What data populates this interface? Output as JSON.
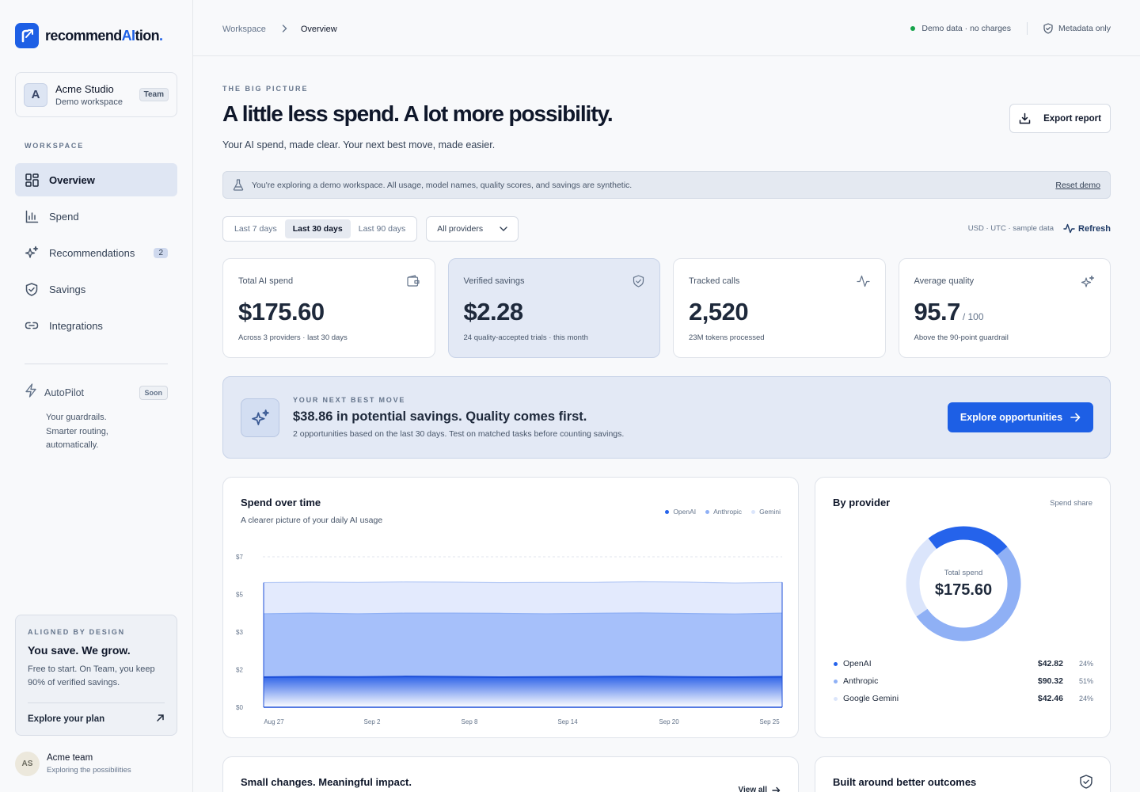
{
  "app": {
    "logo_prefix": "recommend",
    "logo_ai": "AI",
    "logo_suffix": "tion",
    "logo_dot": "."
  },
  "workspace": {
    "initial": "A",
    "name": "Acme Studio",
    "sub": "Demo workspace",
    "badge": "Team"
  },
  "sidebar": {
    "section": "WORKSPACE",
    "items": [
      {
        "label": "Overview",
        "icon": "grid-icon",
        "active": true
      },
      {
        "label": "Spend",
        "icon": "bar-chart-icon"
      },
      {
        "label": "Recommendations",
        "icon": "sparkles-icon",
        "count": "2"
      },
      {
        "label": "Savings",
        "icon": "shield-check-icon"
      },
      {
        "label": "Integrations",
        "icon": "link-icon"
      }
    ],
    "autopilot": {
      "title": "AutoPilot",
      "badge": "Soon",
      "desc": "Your guardrails. Smarter routing, automatically."
    },
    "plan": {
      "kicker": "ALIGNED BY DESIGN",
      "title": "You save. We grow.",
      "desc": "Free to start. On Team, you keep 90% of verified savings.",
      "link": "Explore your plan"
    },
    "user": {
      "initials": "AS",
      "name": "Acme team",
      "sub": "Exploring the possibilities"
    }
  },
  "topbar": {
    "crumb_root": "Workspace",
    "crumb_current": "Overview",
    "status": "Demo data · no charges",
    "privacy": "Metadata only"
  },
  "hero": {
    "kicker": "THE BIG PICTURE",
    "title": "A little less spend. A lot more possibility.",
    "sub": "Your AI spend, made clear. Your next best move, made easier.",
    "export": "Export report"
  },
  "banner": {
    "text": "You're exploring a demo workspace. All usage, model names, quality scores, and savings are synthetic.",
    "reset": "Reset demo"
  },
  "filters": {
    "ranges": [
      "Last 7 days",
      "Last 30 days",
      "Last 90 days"
    ],
    "selected_range": "Last 30 days",
    "provider": "All providers",
    "meta": "USD · UTC · sample data",
    "refresh": "Refresh"
  },
  "kpis": [
    {
      "label": "Total AI spend",
      "value": "$175.60",
      "unit": "",
      "note": "Across 3 providers · last 30 days",
      "icon": "wallet-icon"
    },
    {
      "label": "Verified savings",
      "value": "$2.28",
      "unit": "",
      "note": "24 quality-accepted trials · this month",
      "icon": "shield-check-icon"
    },
    {
      "label": "Tracked calls",
      "value": "2,520",
      "unit": "",
      "note": "23M tokens processed",
      "icon": "activity-icon"
    },
    {
      "label": "Average quality",
      "value": "95.7",
      "unit": "/ 100",
      "note": "Above the 90-point guardrail",
      "icon": "sparkles-icon"
    }
  ],
  "next_move": {
    "kicker": "YOUR NEXT BEST MOVE",
    "title": "$38.86 in potential savings. Quality comes first.",
    "sub": "2 opportunities based on the last 30 days. Test on matched tasks before counting savings.",
    "button": "Explore opportunities"
  },
  "spend_card": {
    "title": "Spend over time",
    "sub": "A clearer picture of your daily AI usage"
  },
  "provider_card": {
    "title": "By provider",
    "right": "Spend share",
    "center_label": "Total spend",
    "center_value": "$175.60",
    "rows": [
      {
        "name": "OpenAI",
        "value": "$42.82",
        "pct": "24%",
        "color": "#2563eb"
      },
      {
        "name": "Anthropic",
        "value": "$90.32",
        "pct": "51%",
        "color": "#8fb0f5"
      },
      {
        "name": "Google Gemini",
        "value": "$42.46",
        "pct": "24%",
        "color": "#dbe5fb"
      }
    ]
  },
  "bottom": {
    "left_title": "Small changes. Meaningful impact.",
    "view_all": "View all",
    "right_title": "Built around better outcomes"
  },
  "colors": {
    "accent": "#1d5fe5",
    "openai": "#2563eb",
    "anthropic": "#8fb0f5",
    "gemini": "#dbe5fb"
  },
  "chart_data": {
    "type": "area",
    "stacked": true,
    "x_ticks": [
      "Aug 27",
      "Sep 2",
      "Sep 8",
      "Sep 14",
      "Sep 20",
      "Sep 25"
    ],
    "y_ticks": [
      "$0",
      "$2",
      "$3",
      "$5",
      "$7"
    ],
    "ylim": [
      0,
      7
    ],
    "legend_position": "top-right",
    "series": [
      {
        "name": "OpenAI",
        "values": [
          1.4,
          1.42,
          1.41,
          1.43,
          1.42,
          1.4,
          1.41,
          1.42,
          1.43,
          1.41,
          1.4,
          1.42
        ]
      },
      {
        "name": "Anthropic",
        "values": [
          2.95,
          2.96,
          2.94,
          2.95,
          2.96,
          2.97,
          2.94,
          2.95,
          2.96,
          2.95,
          2.94,
          2.96
        ]
      },
      {
        "name": "Gemini",
        "values": [
          1.45,
          1.44,
          1.46,
          1.45,
          1.44,
          1.43,
          1.46,
          1.44,
          1.45,
          1.46,
          1.44,
          1.43
        ]
      }
    ]
  }
}
